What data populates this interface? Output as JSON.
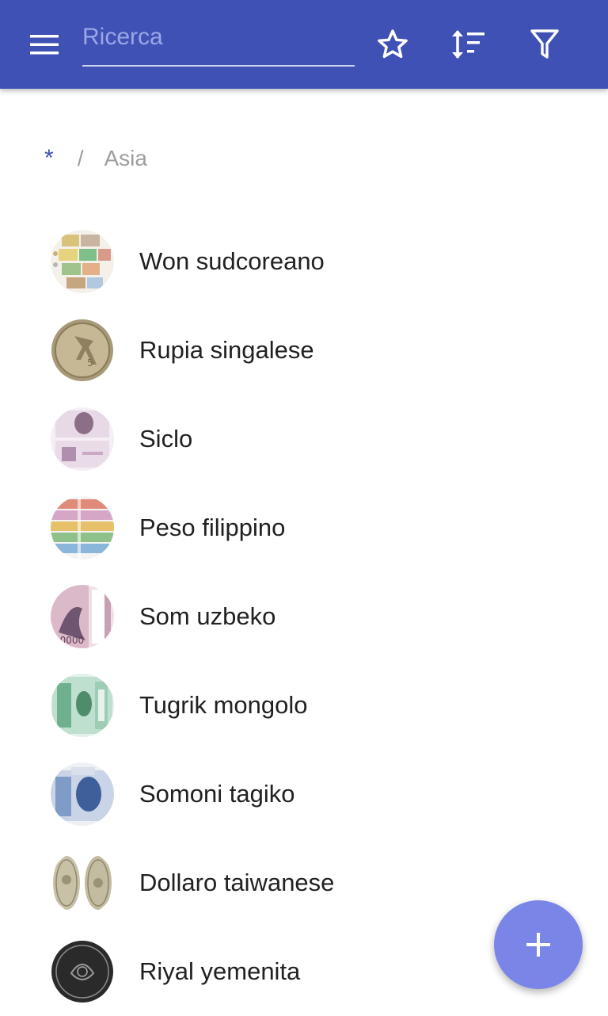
{
  "toolbar": {
    "menu_icon": "hamburger-menu-icon",
    "search_placeholder": "Ricerca",
    "search_value": "",
    "favorite_icon": "star-outline-icon",
    "sort_icon": "sort-icon",
    "filter_icon": "filter-icon",
    "background_color": "#3f51b5"
  },
  "breadcrumb": {
    "root": "*",
    "separator": "/",
    "current": "Asia"
  },
  "items": [
    {
      "label": "Won sudcoreano",
      "thumb": "banknotes-collage"
    },
    {
      "label": "Rupia singalese",
      "thumb": "gold-coin"
    },
    {
      "label": "Siclo",
      "thumb": "purple-banknote"
    },
    {
      "label": "Peso filippino",
      "thumb": "colorful-banknotes"
    },
    {
      "label": "Som uzbeko",
      "thumb": "pink-banknote"
    },
    {
      "label": "Tugrik mongolo",
      "thumb": "green-banknote"
    },
    {
      "label": "Somoni tagiko",
      "thumb": "blue-banknote"
    },
    {
      "label": "Dollaro taiwanese",
      "thumb": "two-silver-coins"
    },
    {
      "label": "Riyal yemenita",
      "thumb": "dark-coin"
    }
  ],
  "fab": {
    "icon": "plus-icon",
    "color": "#7986e8"
  }
}
